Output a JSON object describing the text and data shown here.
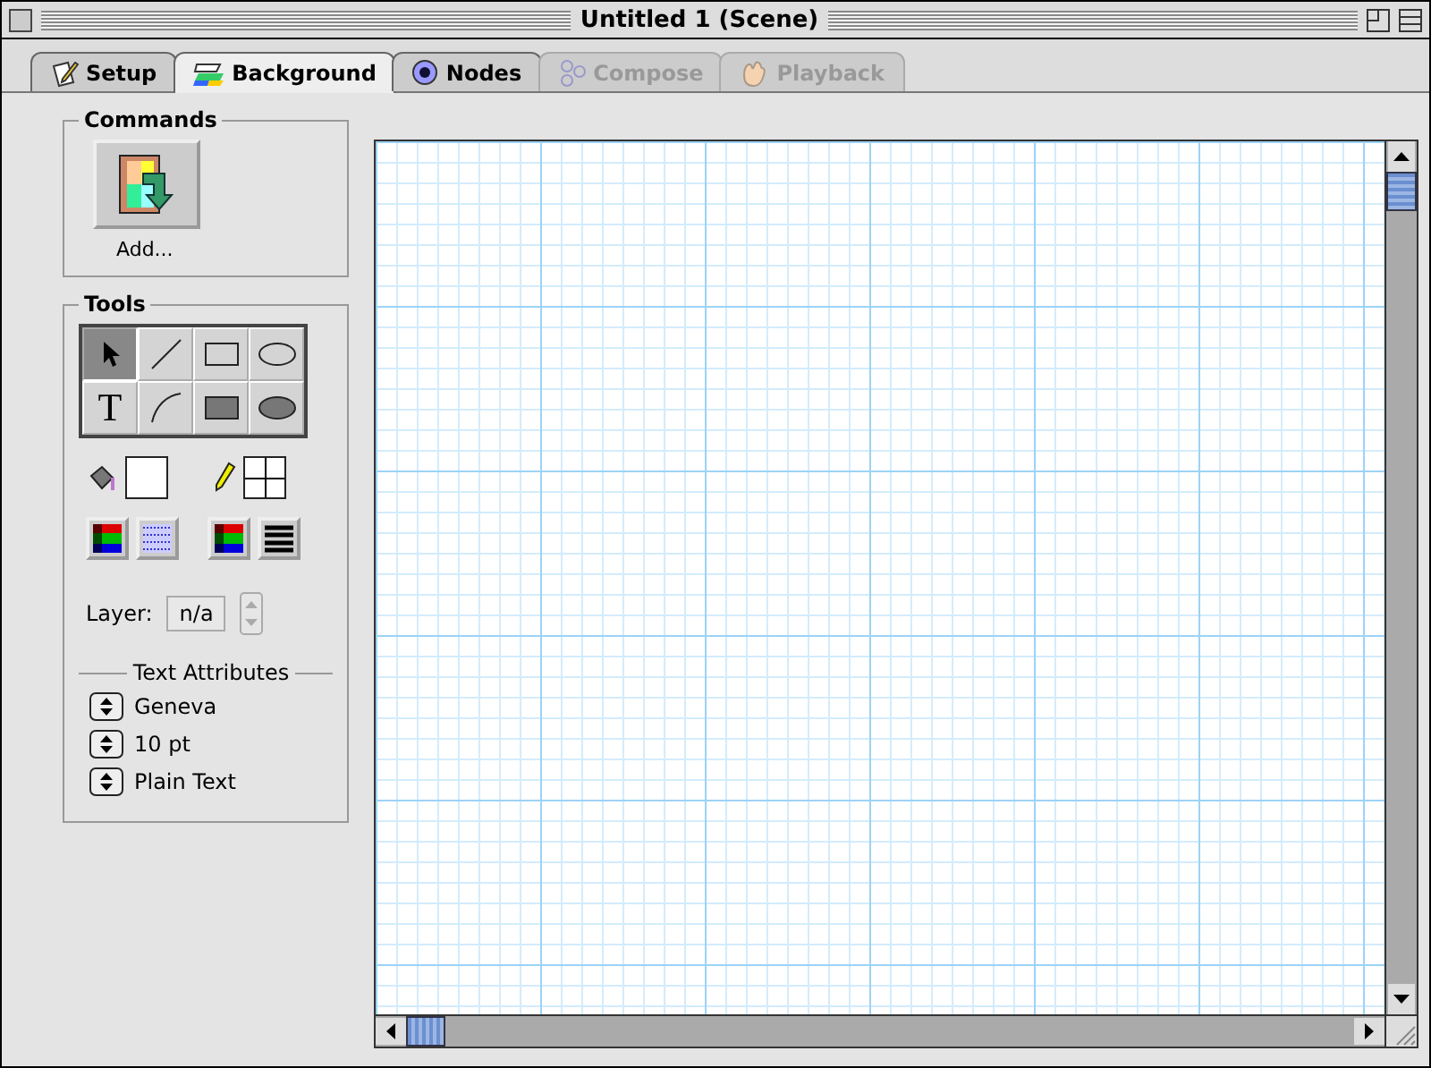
{
  "window": {
    "title": "Untitled 1 (Scene)"
  },
  "tabs": [
    {
      "label": "Setup",
      "kind": "setup",
      "selected": false,
      "disabled": false
    },
    {
      "label": "Background",
      "kind": "background",
      "selected": true,
      "disabled": false
    },
    {
      "label": "Nodes",
      "kind": "nodes",
      "selected": false,
      "disabled": false
    },
    {
      "label": "Compose",
      "kind": "compose",
      "selected": false,
      "disabled": true
    },
    {
      "label": "Playback",
      "kind": "playback",
      "selected": false,
      "disabled": true
    }
  ],
  "commands": {
    "title": "Commands",
    "buttons": [
      {
        "label": "Add..."
      }
    ]
  },
  "tools": {
    "title": "Tools",
    "items": [
      {
        "kind": "arrow",
        "selected": true
      },
      {
        "kind": "line",
        "selected": false
      },
      {
        "kind": "rect",
        "selected": false
      },
      {
        "kind": "oval",
        "selected": false
      },
      {
        "kind": "text",
        "glyph": "T",
        "selected": false
      },
      {
        "kind": "arc",
        "selected": false
      },
      {
        "kind": "filled-rect",
        "selected": false
      },
      {
        "kind": "filled-oval",
        "selected": false
      }
    ],
    "layer": {
      "label": "Layer:",
      "value": "n/a"
    },
    "text_attributes": {
      "title": "Text Attributes",
      "popups": [
        {
          "value": "Geneva"
        },
        {
          "value": "10 pt"
        },
        {
          "value": "Plain Text"
        }
      ]
    }
  }
}
